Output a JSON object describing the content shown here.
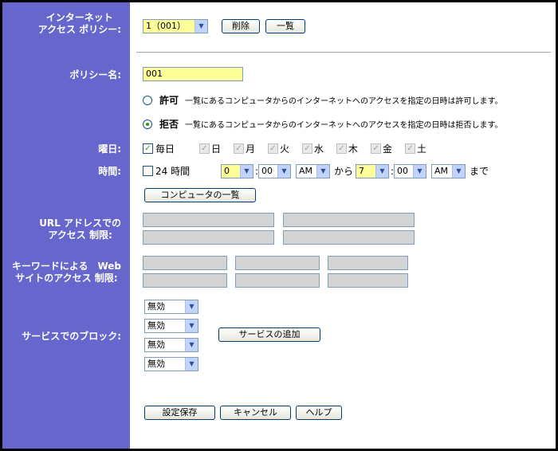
{
  "labels": {
    "policy_line1": "インターネット",
    "policy_line2": "アクセス ポリシー:",
    "policy_name": "ポリシー名:",
    "weekday": "曜日:",
    "time": "時間:",
    "url_line1": "URL アドレスでの",
    "url_line2": "アクセス 制限:",
    "keyword_line1": "キーワードによる　Web",
    "keyword_line2": "サイトのアクセス 制限:",
    "service": "サービスでのブロック:"
  },
  "policy": {
    "selected": "1（001）",
    "delete_label": "削除",
    "list_label": "一覧"
  },
  "policy_name_value": "001",
  "access": {
    "allow_label": "許可",
    "allow_desc": "一覧にあるコンピュータからのインターネットへのアクセスを指定の日時は許可します。",
    "deny_label": "拒否",
    "deny_desc": "一覧にあるコンピュータからのインターネットへのアクセスを指定の日時は拒否します。",
    "selected": "deny"
  },
  "days": {
    "everyday_label": "毎日",
    "everyday_checked": true,
    "items": [
      {
        "label": "日",
        "checked": true
      },
      {
        "label": "月",
        "checked": true
      },
      {
        "label": "火",
        "checked": true
      },
      {
        "label": "水",
        "checked": true
      },
      {
        "label": "木",
        "checked": true
      },
      {
        "label": "金",
        "checked": true
      },
      {
        "label": "土",
        "checked": true
      }
    ]
  },
  "time": {
    "allday_label": "24 時間",
    "allday_checked": false,
    "start_hour": "0",
    "start_min": "00",
    "start_ampm": "AM",
    "from_label": "から",
    "end_hour": "7",
    "end_min": "00",
    "end_ampm": "AM",
    "to_label": "まで",
    "colon": ":"
  },
  "computer_list_label": "コンピュータの一覧",
  "services": {
    "options": [
      "無効",
      "無効",
      "無効",
      "無効"
    ],
    "add_label": "サービスの追加"
  },
  "footer": {
    "save_label": "設定保存",
    "cancel_label": "キャンセル",
    "help_label": "ヘルプ"
  },
  "colors": {
    "sidebar": "#6666cc",
    "field_highlight": "#ffff99",
    "field_disabled": "#d4d4d4"
  }
}
